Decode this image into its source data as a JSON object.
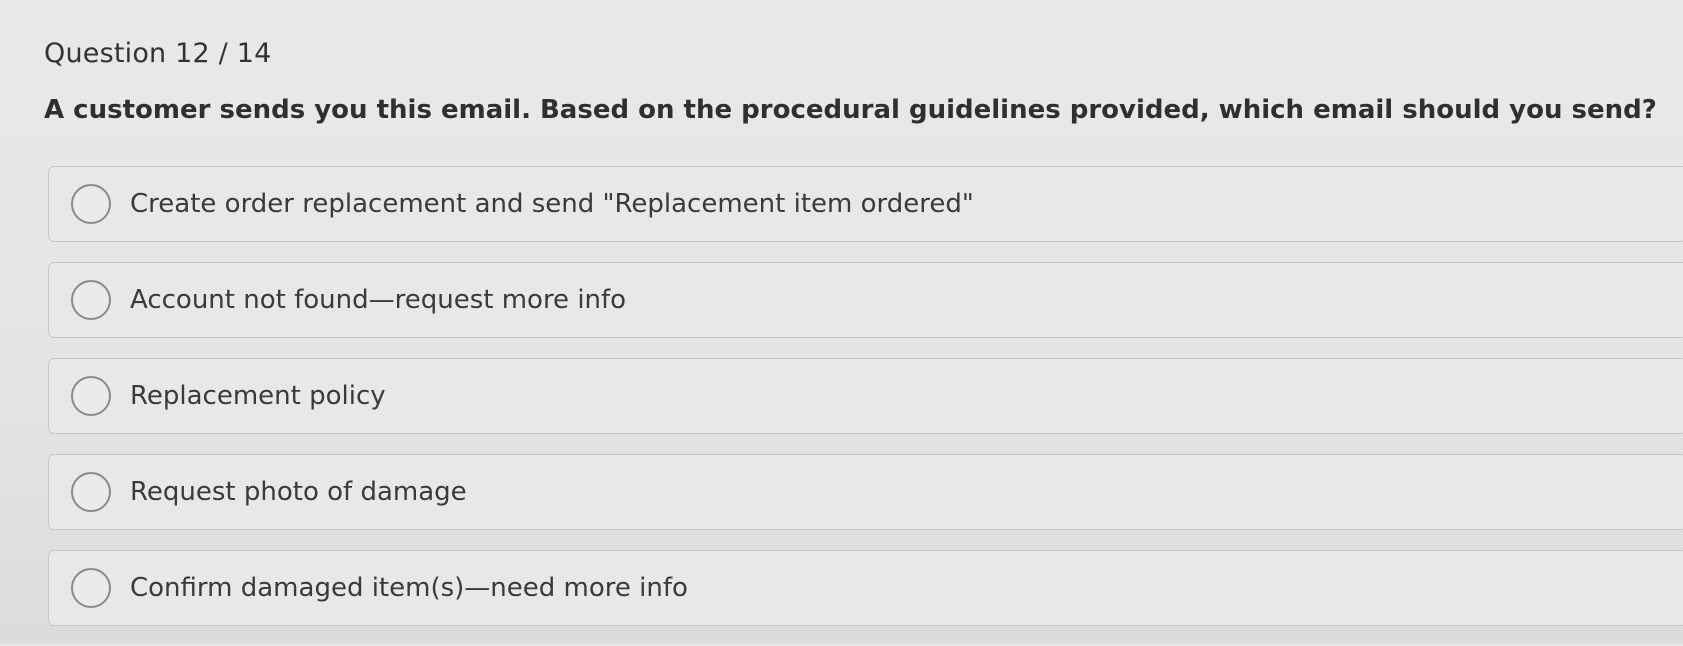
{
  "quiz": {
    "question_counter": "Question 12 / 14",
    "prompt": "A customer sends you this email. Based on the procedural guidelines provided, which email should you send?",
    "options": [
      {
        "label": "Create order replacement and send \"Replacement item ordered\""
      },
      {
        "label": "Account not found—request more info"
      },
      {
        "label": "Replacement policy"
      },
      {
        "label": "Request photo of damage"
      },
      {
        "label": "Confirm damaged item(s)—need more info"
      }
    ]
  }
}
